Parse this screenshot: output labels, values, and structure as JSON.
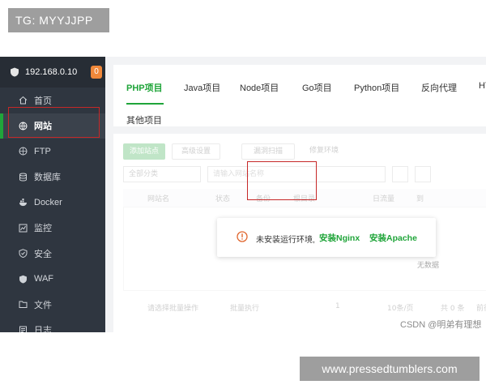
{
  "overlay": {
    "tg_label": "TG: MYYJJPP",
    "site_watermark": "www.pressedtumblers.com",
    "csdn_watermark": "CSDN @明弟有理想"
  },
  "sidebar": {
    "server_ip": "192.168.0.10",
    "notification_count": "0",
    "items": [
      {
        "label": "首页",
        "icon": "home-icon"
      },
      {
        "label": "网站",
        "icon": "globe-icon",
        "active": true
      },
      {
        "label": "FTP",
        "icon": "ftp-icon"
      },
      {
        "label": "数据库",
        "icon": "database-icon"
      },
      {
        "label": "Docker",
        "icon": "docker-icon"
      },
      {
        "label": "监控",
        "icon": "monitor-icon"
      },
      {
        "label": "安全",
        "icon": "shield-icon"
      },
      {
        "label": "WAF",
        "icon": "waf-icon"
      },
      {
        "label": "文件",
        "icon": "folder-icon"
      },
      {
        "label": "日志",
        "icon": "log-icon"
      }
    ]
  },
  "tabs": [
    {
      "label": "PHP项目",
      "active": true
    },
    {
      "label": "Java项目"
    },
    {
      "label": "Node项目"
    },
    {
      "label": "Go项目"
    },
    {
      "label": "Python项目"
    },
    {
      "label": "反向代理"
    },
    {
      "label": "HT"
    },
    {
      "label": "其他项目"
    }
  ],
  "toolbar": {
    "add_site": "添加站点",
    "advanced_settings": "高级设置",
    "vuln_scan": "漏洞扫描",
    "fix_env": "修复环境",
    "filter_select": "全部分类",
    "search_placeholder": "请输入网站名称"
  },
  "table": {
    "headers": [
      "网站名",
      "状态",
      "备份",
      "根目录",
      "日流量",
      "到"
    ],
    "empty_text": "无数据"
  },
  "footer": {
    "batch_select": "请选择批量操作",
    "batch_button": "批量执行",
    "page_current": "1",
    "page_size": "10条/页",
    "total": "共 0 条",
    "goto": "前往"
  },
  "dialog": {
    "message": "未安装运行环境,",
    "install_nginx": "安装Nginx",
    "install_apache": "安装Apache"
  },
  "colors": {
    "accent": "#20a53a",
    "sidebar_bg": "#2f3640",
    "highlight": "#c62828",
    "badge": "#f0883a"
  }
}
